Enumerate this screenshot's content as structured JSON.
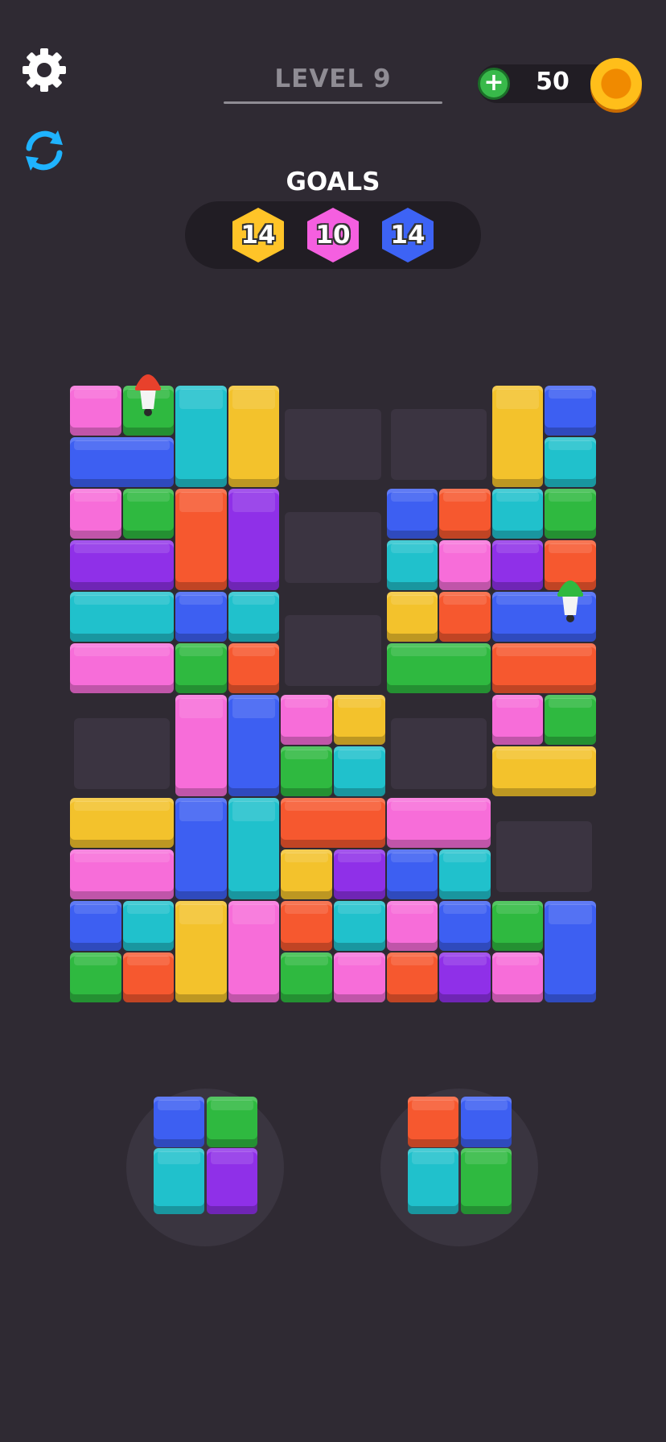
{
  "header": {
    "level_label": "LEVEL 9",
    "coins": "50",
    "add_coins_symbol": "+",
    "settings_icon": "gear-icon",
    "restart_icon": "refresh-icon",
    "coin_icon": "coin-icon"
  },
  "goals": {
    "title": "GOALS",
    "items": [
      {
        "count": "14",
        "color": "#ffc428"
      },
      {
        "count": "10",
        "color": "#f55fe0"
      },
      {
        "count": "14",
        "color": "#3d63f5"
      }
    ]
  },
  "colors": {
    "pink": "#f76dd9",
    "green": "#2fb940",
    "blue": "#3d5ff2",
    "cyan": "#20c1cc",
    "yellow": "#f3c22c",
    "orange": "#f6582f",
    "purple": "#8f30e8",
    "empty": "#3b3441"
  },
  "board": {
    "columns": 10,
    "rows": 12,
    "empty_slots": [
      [
        4,
        0,
        2,
        2
      ],
      [
        4,
        2,
        2,
        2
      ],
      [
        4,
        4,
        2,
        2
      ],
      [
        6,
        0,
        2,
        2
      ],
      [
        0,
        6,
        2,
        2
      ],
      [
        6,
        6,
        2,
        2
      ],
      [
        8,
        8,
        2,
        2
      ]
    ],
    "blocks": [
      [
        0,
        0,
        1,
        1,
        "pink"
      ],
      [
        1,
        0,
        1,
        1,
        "green"
      ],
      [
        2,
        0,
        1,
        2,
        "cyan"
      ],
      [
        3,
        0,
        1,
        2,
        "yellow"
      ],
      [
        8,
        0,
        1,
        2,
        "yellow"
      ],
      [
        9,
        0,
        1,
        1,
        "blue"
      ],
      [
        0,
        1,
        2,
        1,
        "blue"
      ],
      [
        9,
        1,
        1,
        1,
        "cyan"
      ],
      [
        0,
        2,
        1,
        1,
        "pink"
      ],
      [
        1,
        2,
        1,
        1,
        "green"
      ],
      [
        2,
        2,
        1,
        2,
        "orange"
      ],
      [
        3,
        2,
        1,
        2,
        "purple"
      ],
      [
        6,
        2,
        1,
        1,
        "blue"
      ],
      [
        7,
        2,
        1,
        1,
        "orange"
      ],
      [
        8,
        2,
        1,
        1,
        "cyan"
      ],
      [
        9,
        2,
        1,
        1,
        "green"
      ],
      [
        0,
        3,
        2,
        1,
        "purple"
      ],
      [
        6,
        3,
        1,
        1,
        "cyan"
      ],
      [
        7,
        3,
        1,
        1,
        "pink"
      ],
      [
        8,
        3,
        1,
        1,
        "purple"
      ],
      [
        9,
        3,
        1,
        1,
        "orange"
      ],
      [
        0,
        4,
        2,
        1,
        "cyan"
      ],
      [
        2,
        4,
        1,
        1,
        "blue"
      ],
      [
        3,
        4,
        1,
        1,
        "cyan"
      ],
      [
        6,
        4,
        1,
        1,
        "yellow"
      ],
      [
        7,
        4,
        1,
        1,
        "orange"
      ],
      [
        8,
        4,
        2,
        1,
        "blue"
      ],
      [
        0,
        5,
        2,
        1,
        "pink"
      ],
      [
        2,
        5,
        1,
        1,
        "green"
      ],
      [
        3,
        5,
        1,
        1,
        "orange"
      ],
      [
        6,
        5,
        2,
        1,
        "green"
      ],
      [
        8,
        5,
        2,
        1,
        "orange"
      ],
      [
        2,
        6,
        1,
        2,
        "pink"
      ],
      [
        3,
        6,
        1,
        2,
        "blue"
      ],
      [
        4,
        6,
        1,
        1,
        "pink"
      ],
      [
        5,
        6,
        1,
        1,
        "yellow"
      ],
      [
        8,
        6,
        1,
        1,
        "pink"
      ],
      [
        9,
        6,
        1,
        1,
        "green"
      ],
      [
        4,
        7,
        1,
        1,
        "green"
      ],
      [
        5,
        7,
        1,
        1,
        "cyan"
      ],
      [
        8,
        7,
        2,
        1,
        "yellow"
      ],
      [
        0,
        8,
        2,
        1,
        "yellow"
      ],
      [
        2,
        8,
        1,
        2,
        "blue"
      ],
      [
        3,
        8,
        1,
        2,
        "cyan"
      ],
      [
        4,
        8,
        2,
        1,
        "orange"
      ],
      [
        6,
        8,
        2,
        1,
        "pink"
      ],
      [
        0,
        9,
        2,
        1,
        "pink"
      ],
      [
        4,
        9,
        1,
        1,
        "yellow"
      ],
      [
        5,
        9,
        1,
        1,
        "purple"
      ],
      [
        6,
        9,
        1,
        1,
        "blue"
      ],
      [
        7,
        9,
        1,
        1,
        "cyan"
      ],
      [
        0,
        10,
        1,
        1,
        "blue"
      ],
      [
        1,
        10,
        1,
        1,
        "cyan"
      ],
      [
        2,
        10,
        1,
        2,
        "yellow"
      ],
      [
        3,
        10,
        1,
        2,
        "pink"
      ],
      [
        4,
        10,
        1,
        1,
        "orange"
      ],
      [
        5,
        10,
        1,
        1,
        "cyan"
      ],
      [
        6,
        10,
        1,
        1,
        "pink"
      ],
      [
        7,
        10,
        1,
        1,
        "blue"
      ],
      [
        8,
        10,
        1,
        1,
        "green"
      ],
      [
        9,
        10,
        1,
        2,
        "blue"
      ],
      [
        0,
        11,
        1,
        1,
        "green"
      ],
      [
        1,
        11,
        1,
        1,
        "orange"
      ],
      [
        4,
        11,
        1,
        1,
        "green"
      ],
      [
        5,
        11,
        1,
        1,
        "pink"
      ],
      [
        6,
        11,
        1,
        1,
        "orange"
      ],
      [
        7,
        11,
        1,
        1,
        "purple"
      ],
      [
        8,
        11,
        1,
        1,
        "pink"
      ]
    ],
    "pins": [
      {
        "col": 1,
        "row": 0,
        "color": "#e8412c"
      },
      {
        "col": 9,
        "row": 4,
        "color": "#2fb940"
      }
    ]
  },
  "tray": {
    "pieces": [
      {
        "cells": [
          "blue",
          "green",
          "cyan",
          "purple"
        ]
      },
      {
        "cells": [
          "orange",
          "blue",
          "cyan",
          "green"
        ]
      }
    ]
  }
}
